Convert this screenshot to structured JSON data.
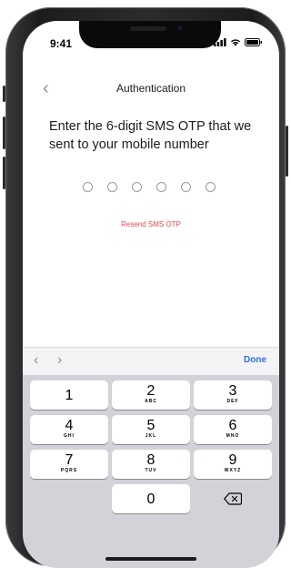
{
  "status_bar": {
    "time": "9:41",
    "icons": [
      "signal-icon",
      "wifi-icon",
      "battery-icon"
    ]
  },
  "nav": {
    "back_icon": "chevron-left-icon",
    "back_glyph": "‹",
    "title": "Authentication"
  },
  "content": {
    "heading": "Enter the 6-digit SMS OTP that we sent to your mobile number",
    "otp_length": 6,
    "resend_label": "Resend SMS OTP"
  },
  "keyboard_toolbar": {
    "prev_glyph": "‹",
    "next_glyph": "›",
    "done_label": "Done"
  },
  "keypad": {
    "keys": [
      {
        "digit": "1",
        "letters": ""
      },
      {
        "digit": "2",
        "letters": "ABC"
      },
      {
        "digit": "3",
        "letters": "DEF"
      },
      {
        "digit": "4",
        "letters": "GHI"
      },
      {
        "digit": "5",
        "letters": "JKL"
      },
      {
        "digit": "6",
        "letters": "MNO"
      },
      {
        "digit": "7",
        "letters": "PQRS"
      },
      {
        "digit": "8",
        "letters": "TUV"
      },
      {
        "digit": "9",
        "letters": "WXYZ"
      },
      {
        "digit": "0",
        "letters": ""
      }
    ],
    "delete_icon": "backspace-icon"
  },
  "colors": {
    "accent_link": "#2f6fe0",
    "resend": "#e5484d",
    "keyboard_bg": "#d1d3d9"
  }
}
